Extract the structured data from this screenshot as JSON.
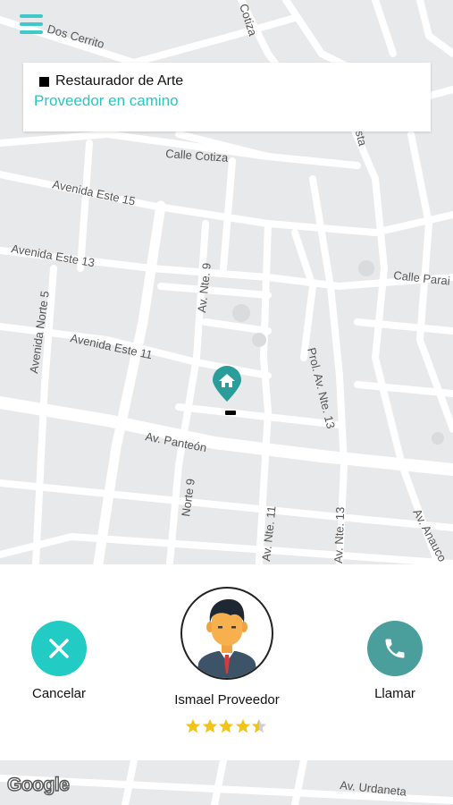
{
  "map": {
    "streets": {
      "dos_cerritos": "Dos Cerrito",
      "cotiza_top": "Cotiza",
      "calle_cotiza": "Calle Cotiza",
      "avenida_este_15": "Avenida Este 15",
      "avenida_este_13": "Avenida Este 13",
      "avenida_norte_5": "Avenida Norte 5",
      "avenida_este_11": "Avenida Este 11",
      "av_nte_9": "Av. Nte. 9",
      "prol_av_nte_13": "Prol. Av. Nte. 13",
      "calle_paraiso": "Calle Parai",
      "costa": "osta",
      "av_panteon": "Av. Panteón",
      "norte_9": "Norte 9",
      "av_nte_11": "Av. Nte. 11",
      "av_nte_13": "Av. Nte. 13",
      "av_anaucos": "Av. Anauco",
      "av_urdaneta": "Av. Urdaneta"
    },
    "attribution": "Google"
  },
  "info_card": {
    "service_name": "Restaurador de Arte",
    "status": "Proveedor en camino"
  },
  "provider": {
    "name": "Ismael Proveedor",
    "rating": 4.5,
    "rating_max": 5
  },
  "actions": {
    "cancel_label": "Cancelar",
    "call_label": "Llamar"
  },
  "colors": {
    "accent": "#25c7c4",
    "call_button": "#4a9f9c",
    "star": "#f2c318"
  }
}
